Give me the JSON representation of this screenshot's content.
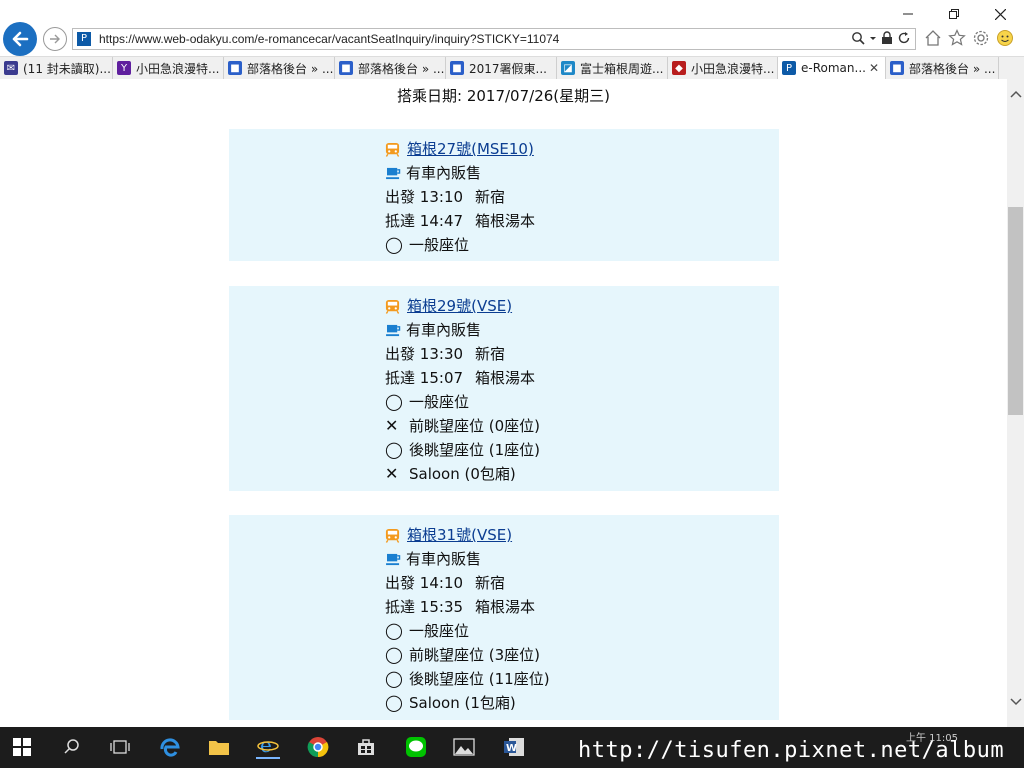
{
  "browser": {
    "url": "https://www.web-odakyu.com/e-romancecar/vacantSeatInquiry/inquiry?STICKY=11074",
    "tabs": [
      {
        "label": "(11 封未讀取)...",
        "icon": "mail-icon",
        "active": false
      },
      {
        "label": "小田急浪漫特...",
        "icon": "yahoo-icon",
        "active": false
      },
      {
        "label": "部落格後台 » ...",
        "icon": "blog-icon",
        "active": false
      },
      {
        "label": "部落格後台 » ...",
        "icon": "blog-icon",
        "active": false
      },
      {
        "label": "2017署假東...",
        "icon": "blog-icon",
        "active": false
      },
      {
        "label": "富士箱根周遊...",
        "icon": "site-icon",
        "active": false
      },
      {
        "label": "小田急浪漫特...",
        "icon": "odakyu-icon",
        "active": false
      },
      {
        "label": "e-Roman...",
        "icon": "e-romance-icon",
        "active": true
      },
      {
        "label": "部落格後台 » ...",
        "icon": "blog-icon",
        "active": false
      }
    ]
  },
  "page": {
    "boarding_date": "搭乘日期: 2017/07/26(星期三)",
    "trains": [
      {
        "name": "箱根27號(MSE10)",
        "service": "有車內販售",
        "depart": {
          "label": "出發",
          "time": "13:10",
          "station": "新宿"
        },
        "arrive": {
          "label": "抵達",
          "time": "14:47",
          "station": "箱根湯本"
        },
        "seats": [
          {
            "symbol": "◯",
            "text": "一般座位"
          }
        ]
      },
      {
        "name": "箱根29號(VSE)",
        "service": "有車內販售",
        "depart": {
          "label": "出發",
          "time": "13:30",
          "station": "新宿"
        },
        "arrive": {
          "label": "抵達",
          "time": "15:07",
          "station": "箱根湯本"
        },
        "seats": [
          {
            "symbol": "◯",
            "text": "一般座位"
          },
          {
            "symbol": "✕",
            "text": "前眺望座位 (0座位)"
          },
          {
            "symbol": "◯",
            "text": "後眺望座位 (1座位)"
          },
          {
            "symbol": "✕",
            "text": "Saloon (0包廂)"
          }
        ]
      },
      {
        "name": "箱根31號(VSE)",
        "service": "有車內販售",
        "depart": {
          "label": "出發",
          "time": "14:10",
          "station": "新宿"
        },
        "arrive": {
          "label": "抵達",
          "time": "15:35",
          "station": "箱根湯本"
        },
        "seats": [
          {
            "symbol": "◯",
            "text": "一般座位"
          },
          {
            "symbol": "◯",
            "text": "前眺望座位 (3座位)"
          },
          {
            "symbol": "◯",
            "text": "後眺望座位 (11座位)"
          },
          {
            "symbol": "◯",
            "text": "Saloon (1包廂)"
          }
        ]
      }
    ]
  },
  "taskbar": {
    "watermark": "http://tisufen.pixnet.net/album",
    "clock": "上午 11:05"
  },
  "colors": {
    "card_bg": "#e6f6fc",
    "train_icon": "#f39a1e",
    "cafe_icon": "#1a7fd0",
    "link": "#0b3d91"
  }
}
